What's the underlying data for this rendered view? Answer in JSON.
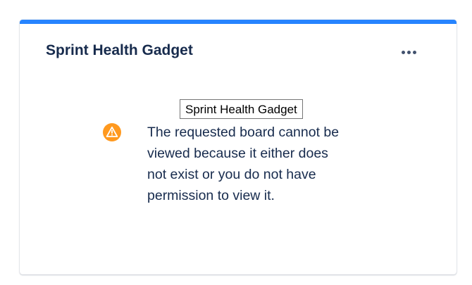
{
  "gadget": {
    "title": "Sprint Health Gadget",
    "menu_icon": "more-horizontal-icon",
    "accent_color": "#2684ff"
  },
  "tooltip": {
    "text": "Sprint Health Gadget"
  },
  "error": {
    "icon": "warning-icon",
    "icon_color": "#ff991f",
    "message": "The requested board cannot be viewed because it either does not exist or you do not have permission to view it."
  }
}
